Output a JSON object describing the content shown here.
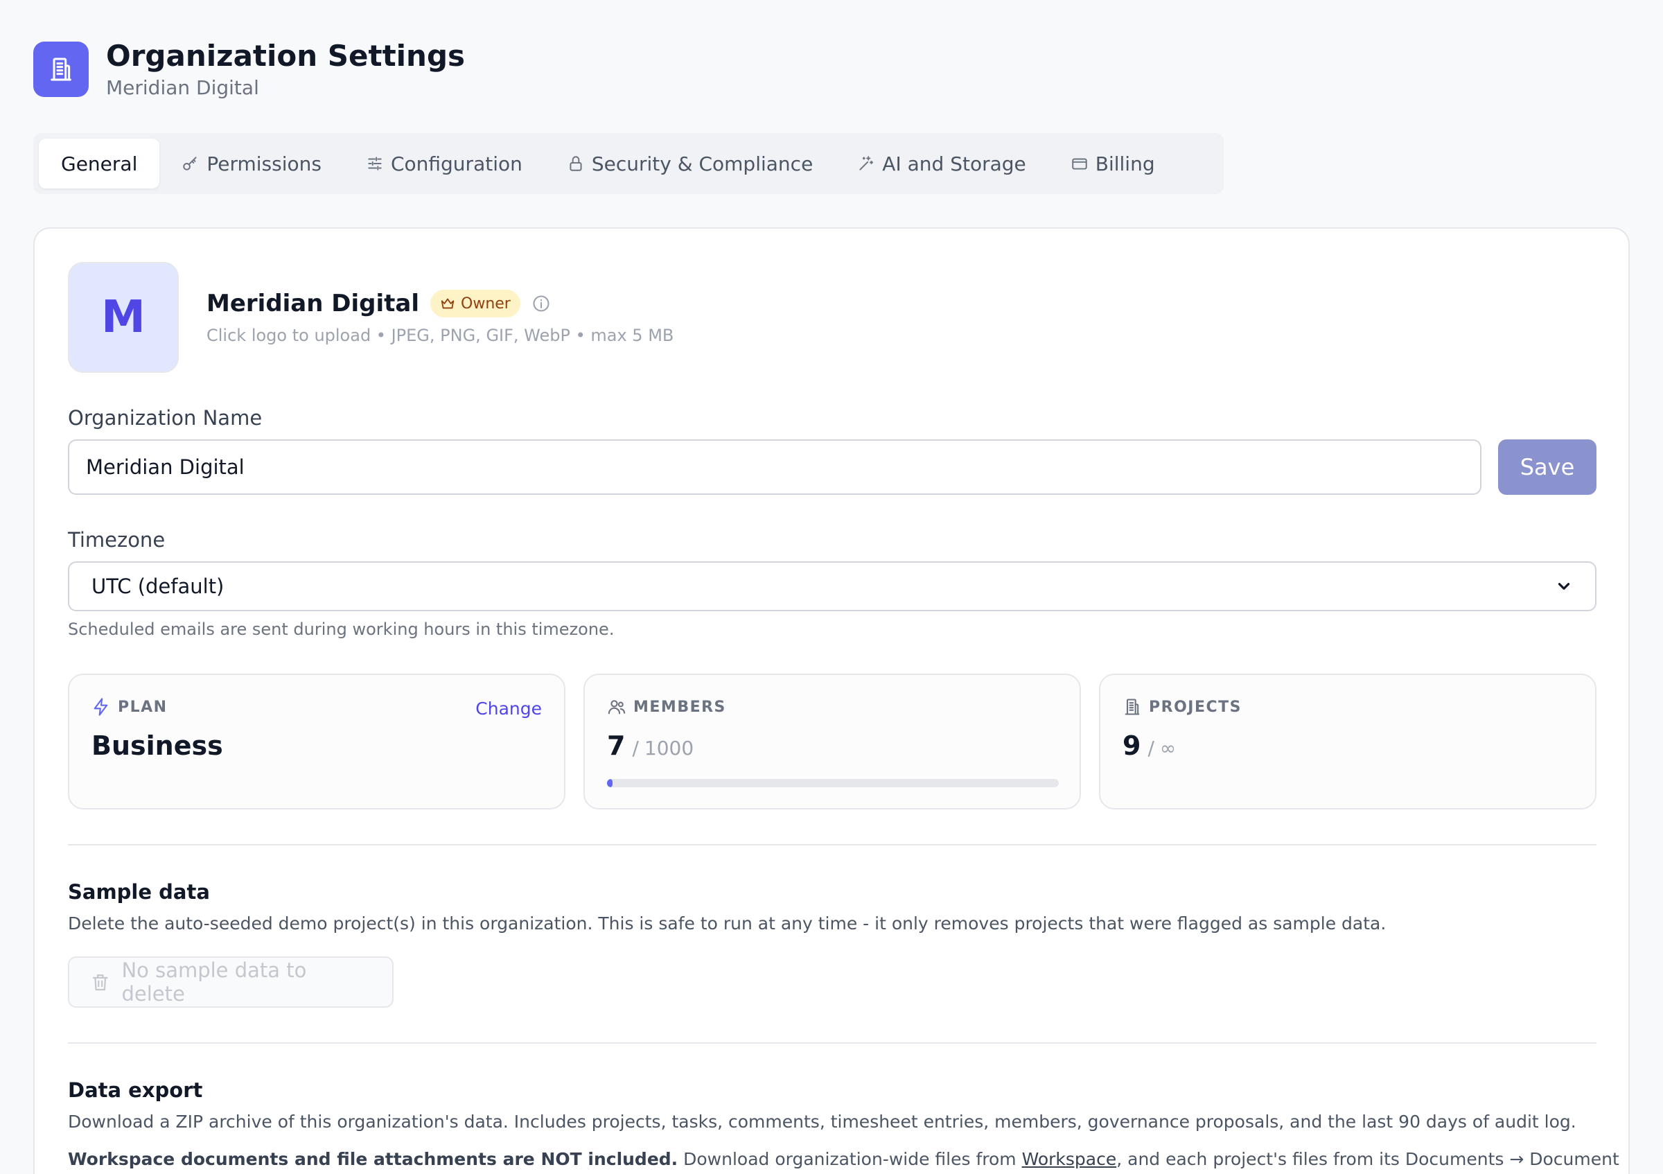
{
  "header": {
    "icon": "building-icon",
    "title": "Organization Settings",
    "subtitle": "Meridian Digital"
  },
  "tabs": [
    {
      "label": "General",
      "icon": "",
      "active": true
    },
    {
      "label": "Permissions",
      "icon": "key-icon"
    },
    {
      "label": "Configuration",
      "icon": "sliders-icon"
    },
    {
      "label": "Security & Compliance",
      "icon": "lock-icon"
    },
    {
      "label": "AI and Storage",
      "icon": "sparkles-icon"
    },
    {
      "label": "Billing",
      "icon": "credit-card-icon"
    }
  ],
  "org": {
    "logo_letter": "M",
    "name": "Meridian Digital",
    "role_badge": "Owner",
    "upload_hint": "Click logo to upload • JPEG, PNG, GIF, WebP • max 5 MB"
  },
  "name_field": {
    "label": "Organization Name",
    "value": "Meridian Digital",
    "save_label": "Save"
  },
  "timezone": {
    "label": "Timezone",
    "selected": "UTC (default)",
    "hint": "Scheduled emails are sent during working hours in this timezone."
  },
  "stats": {
    "plan": {
      "label": "PLAN",
      "value": "Business",
      "action": "Change"
    },
    "members": {
      "label": "MEMBERS",
      "count": "7",
      "separator": "/",
      "limit": "1000",
      "usage_fraction": 0.007
    },
    "projects": {
      "label": "PROJECTS",
      "count": "9",
      "separator": "/",
      "limit": "∞"
    }
  },
  "sample_data": {
    "title": "Sample data",
    "description": "Delete the auto-seeded demo project(s) in this organization. This is safe to run at any time - it only removes projects that were flagged as sample data.",
    "button_label": "No sample data to delete"
  },
  "data_export": {
    "title": "Data export",
    "description": "Download a ZIP archive of this organization's data. Includes projects, tasks, comments, timesheet entries, members, governance proposals, and the last 90 days of audit log.",
    "note_bold": "Workspace documents and file attachments are NOT included.",
    "note_text_1": " Download organization-wide files from ",
    "note_link": "Workspace",
    "note_text_2": ", and each project's files from its Documents → Document"
  },
  "colors": {
    "accent": "#6366f1",
    "accent_text": "#4f46e5",
    "badge_bg": "#fef3c7",
    "save_button": "#8b93cf"
  }
}
